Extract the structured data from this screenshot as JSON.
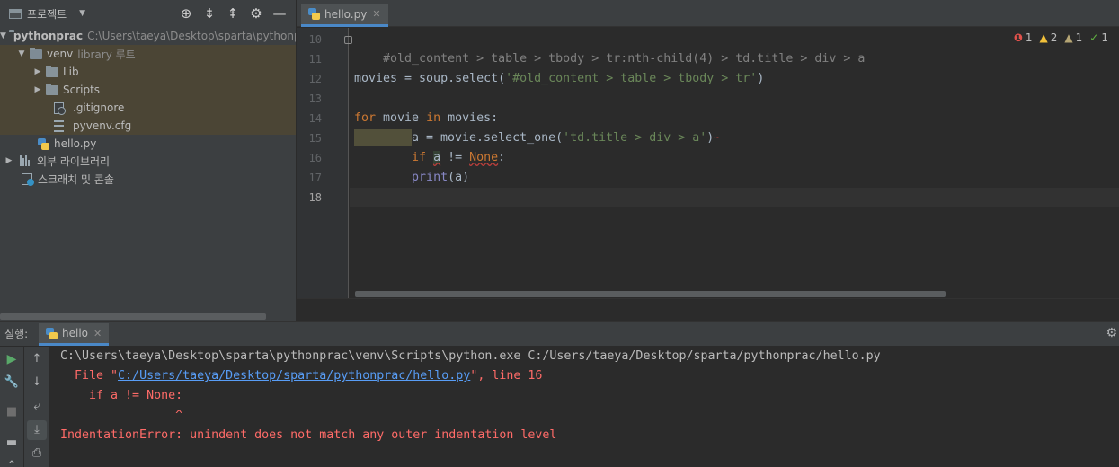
{
  "project": {
    "title": "프로젝트",
    "tree": {
      "root": {
        "name": "pythonprac",
        "path": "C:\\Users\\taeya\\Desktop\\sparta\\pythonprac"
      },
      "venv": {
        "name": "venv",
        "hint": "library 루트"
      },
      "lib": "Lib",
      "scripts": "Scripts",
      "gitignore": ".gitignore",
      "pyvenv": "pyvenv.cfg",
      "hello": "hello.py",
      "external": "외부 라이브러리",
      "scratches": "스크래치 및 콘솔"
    }
  },
  "editor": {
    "tab": "hello.py",
    "inspections": {
      "errors": "1",
      "warnings": "2",
      "weak": "1",
      "ok": "1"
    },
    "lines": [
      {
        "num": "10",
        "text": "#old_content > table > tbody > tr:nth-child(4) > td.title > div > a"
      },
      {
        "num": "11",
        "text": ""
      },
      {
        "num": "12",
        "p1": "movies = soup.select(",
        "p2": "'#old_content > table > tbody > tr'",
        "p3": ")"
      },
      {
        "num": "13",
        "text": ""
      },
      {
        "num": "14",
        "kw": "for",
        "v1": " movie ",
        "kw2": "in",
        "v2": " movies:"
      },
      {
        "num": "15",
        "p1": "a = movie.select_one(",
        "p2": "'td.title > div > a'",
        "p3": ")"
      },
      {
        "num": "16",
        "kw": "if",
        "var": "a",
        "op": " != ",
        "none": "None",
        "end": ":"
      },
      {
        "num": "17",
        "fn": "print",
        "args": "(a)"
      },
      {
        "num": "18",
        "text": ""
      }
    ]
  },
  "run": {
    "label": "실행:",
    "tab": "hello",
    "output": {
      "cmd": "C:\\Users\\taeya\\Desktop\\sparta\\pythonprac\\venv\\Scripts\\python.exe C:/Users/taeya/Desktop/sparta/pythonprac/hello.py",
      "file_pre": "  File \"",
      "file_link": "C:/Users/taeya/Desktop/sparta/pythonprac/hello.py",
      "file_post": "\", line 16",
      "code": "    if a != None:",
      "caret": "                ^",
      "error": "IndentationError: unindent does not match any outer indentation level"
    }
  }
}
